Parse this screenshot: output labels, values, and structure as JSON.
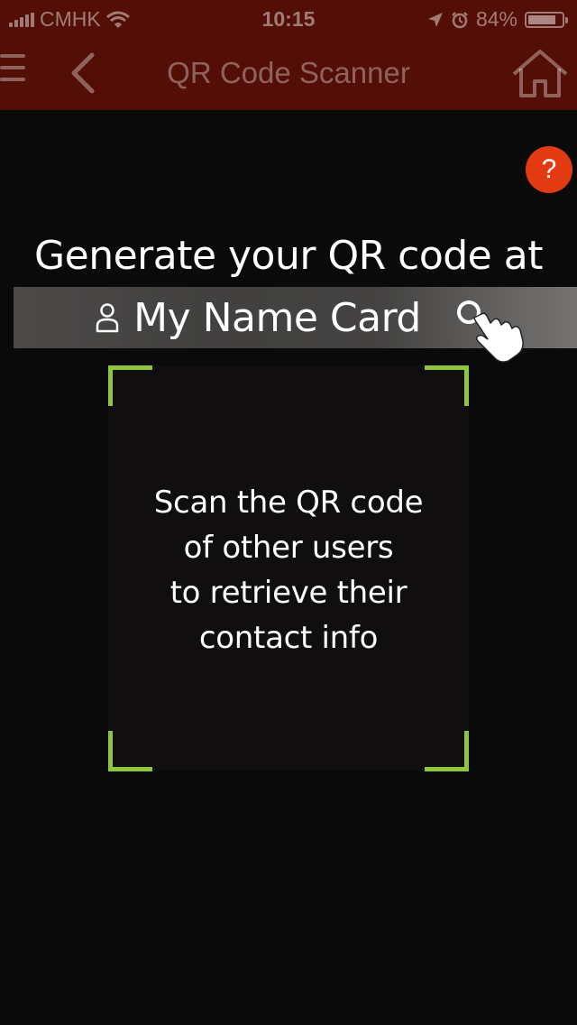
{
  "status_bar": {
    "carrier": "CMHK",
    "time": "10:15",
    "battery_percent_label": "84%",
    "battery_level": 0.84
  },
  "nav": {
    "title": "QR Code Scanner",
    "menu_icon": "hamburger-menu-icon",
    "back_icon": "chevron-left-icon",
    "home_icon": "home-icon"
  },
  "help": {
    "label": "?"
  },
  "prompt": {
    "line1": "Generate your QR code at",
    "name_card_label": "My Name Card"
  },
  "scanner": {
    "instructions": [
      "Scan the QR code",
      "of other users",
      "to retrieve their",
      "contact info"
    ]
  },
  "colors": {
    "header_red": "#b8230e",
    "help_orange": "#e43a12",
    "frame_green": "#8fc63c",
    "background": "#0b0a0a"
  }
}
